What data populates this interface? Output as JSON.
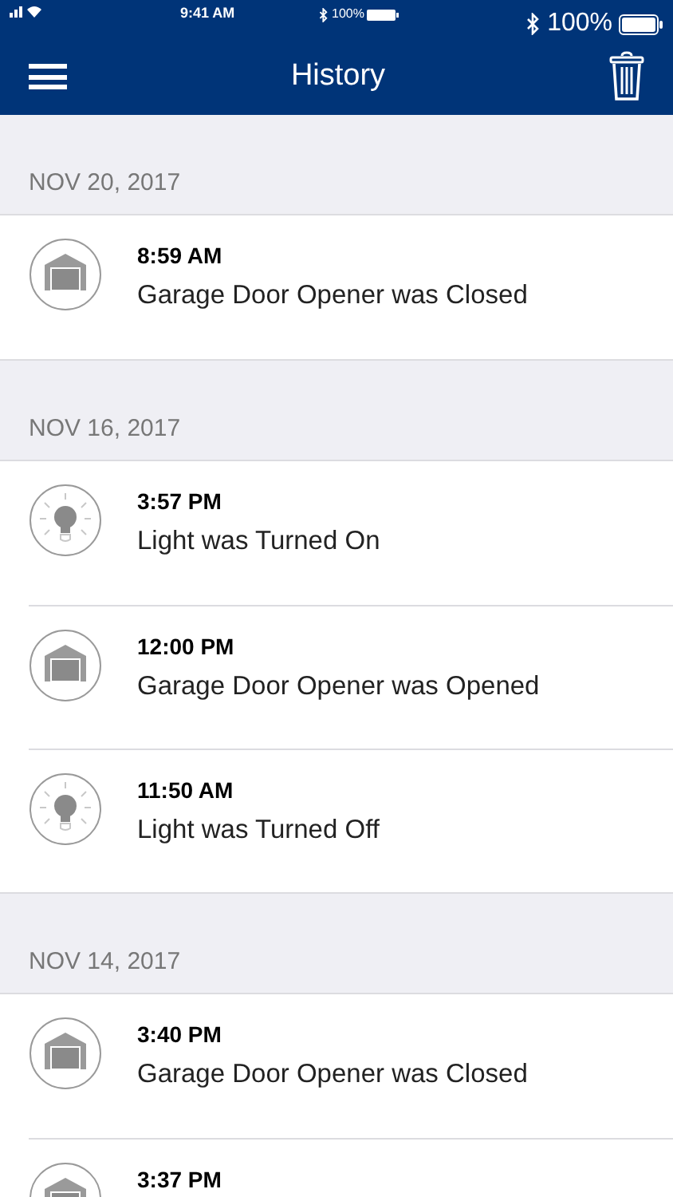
{
  "status_bar": {
    "time": "9:41 AM",
    "center_battery": "100%",
    "right_battery": "100%"
  },
  "nav_bar": {
    "title": "History"
  },
  "sections": [
    {
      "date": "NOV 20, 2017",
      "events": [
        {
          "kind": "garage",
          "time": "8:59 AM",
          "description": "Garage Door Opener was Closed"
        }
      ]
    },
    {
      "date": "NOV 16, 2017",
      "events": [
        {
          "kind": "light",
          "time": "3:57 PM",
          "description": "Light was Turned On"
        },
        {
          "kind": "garage",
          "time": "12:00 PM",
          "description": "Garage Door Opener was Opened"
        },
        {
          "kind": "light",
          "time": "11:50 AM",
          "description": "Light was Turned Off"
        }
      ]
    },
    {
      "date": "NOV 14, 2017",
      "events": [
        {
          "kind": "garage",
          "time": "3:40 PM",
          "description": "Garage Door Opener was Closed"
        },
        {
          "kind": "garage",
          "time": "3:37 PM"
        }
      ]
    }
  ]
}
